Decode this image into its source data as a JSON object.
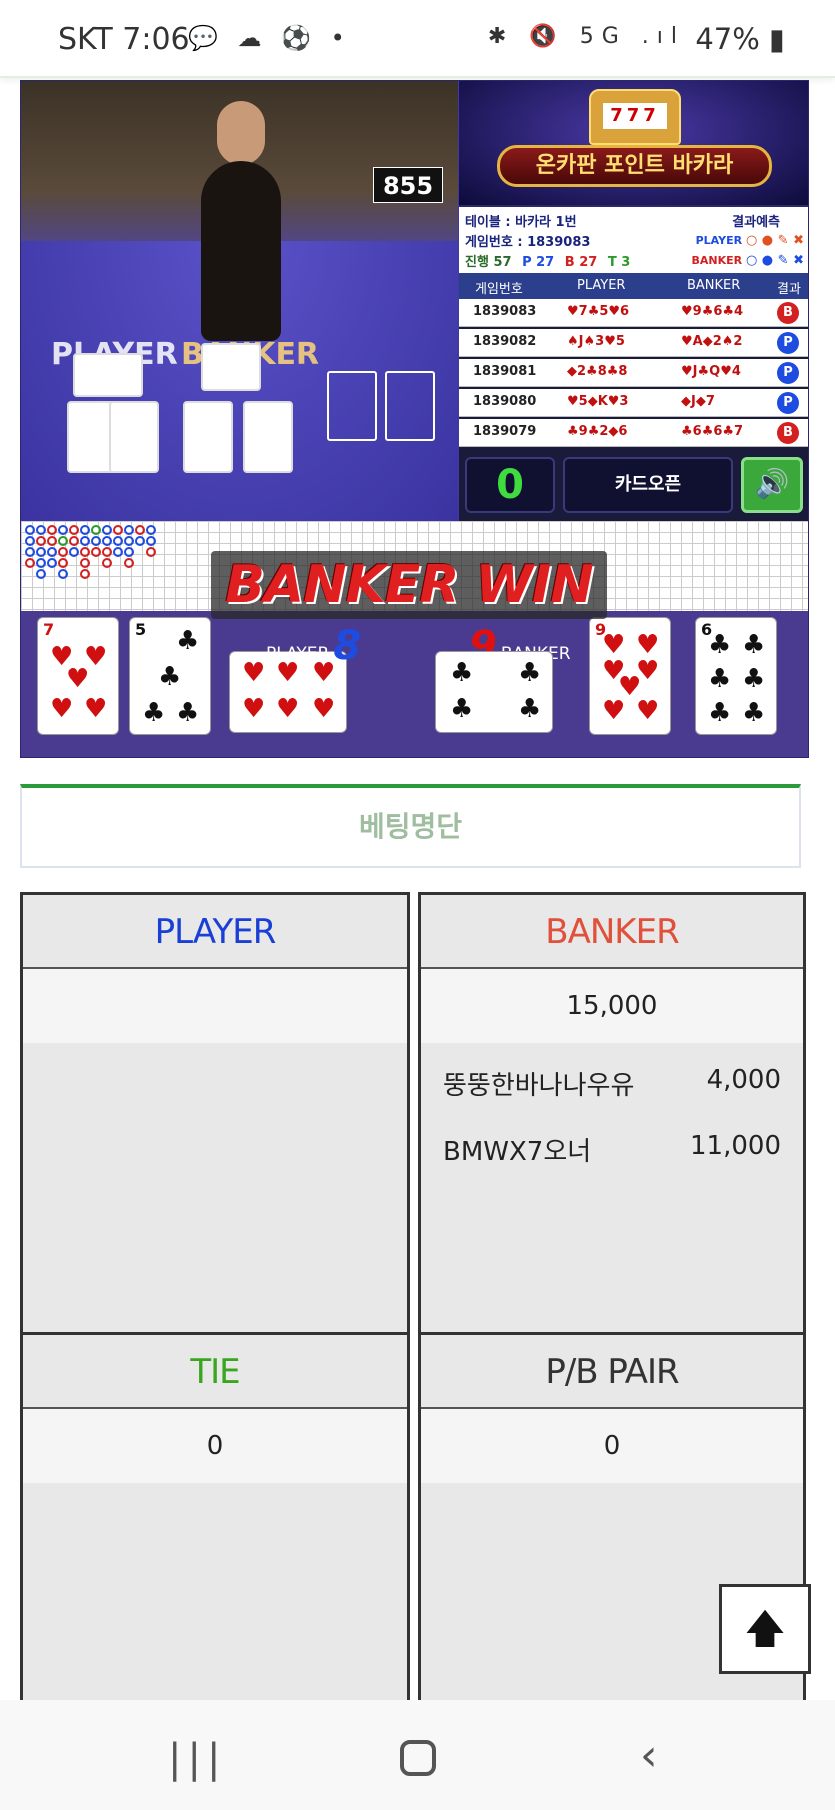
{
  "status_bar": {
    "carrier_time": "SKT 7:06",
    "left_icons": "💬 ☁ ⚽ •",
    "system_icons": "✱ 🔇 5G .ıl",
    "battery": "47%"
  },
  "game": {
    "shoe_counter": "855",
    "felt_player_label": "PLAYER",
    "felt_banker_label": "BANKER",
    "banner_title": "온카판 포인트 바카라",
    "slot_display": "777",
    "info": {
      "table": "테이블 : 바카라 1번",
      "game_no": "게임번호 : 1839083",
      "progress_label": "진행 57",
      "p_count": "P 27",
      "b_count": "B 27",
      "t_count": "T 3",
      "predict_title": "결과예측",
      "predict_player": "PLAYER",
      "predict_banker": "BANKER",
      "predict_player_marks": "○ ● ✎ ✖",
      "predict_banker_marks": "○ ● ✎ ✖"
    },
    "history_headers": [
      "게임번호",
      "PLAYER",
      "BANKER",
      "결과"
    ],
    "history": [
      {
        "no": "1839083",
        "player": "♥7♣5♥6",
        "banker": "♥9♣6♣4",
        "result": "B",
        "result_type": "banker"
      },
      {
        "no": "1839082",
        "player": "♠J♠3♥5",
        "banker": "♥A◆2♠2",
        "result": "P",
        "result_type": "player"
      },
      {
        "no": "1839081",
        "player": "◆2♣8♣8",
        "banker": "♥J♣Q♥4",
        "result": "P",
        "result_type": "player"
      },
      {
        "no": "1839080",
        "player": "♥5◆K♥3",
        "banker": "◆J◆7",
        "result": "P",
        "result_type": "player"
      },
      {
        "no": "1839079",
        "player": "♣9♣2◆6",
        "banker": "♣6♣6♣7",
        "result": "B",
        "result_type": "banker"
      }
    ],
    "counter": "0",
    "card_open_label": "카드오픈",
    "sound_icon": "speaker-icon",
    "win_banner": "BANKER WIN",
    "player_score_label": "PLAYER",
    "player_score": "8",
    "banker_score_label": "BANKER",
    "banker_score": "9",
    "player_cards": [
      {
        "rank": "7",
        "suit": "♥",
        "color": "red"
      },
      {
        "rank": "5",
        "suit": "♣",
        "color": "black"
      },
      {
        "rank": "6",
        "suit": "♥",
        "color": "red"
      }
    ],
    "banker_cards": [
      {
        "rank": "4",
        "suit": "♣",
        "color": "black"
      },
      {
        "rank": "9",
        "suit": "♥",
        "color": "red"
      },
      {
        "rank": "6",
        "suit": "♣",
        "color": "black"
      }
    ]
  },
  "betting": {
    "title": "베팅명단",
    "player": {
      "header": "PLAYER",
      "color": "#1a3fd6",
      "total": ""
    },
    "banker": {
      "header": "BANKER",
      "color": "#e0503a",
      "total": "15,000",
      "rows": [
        {
          "name": "뚱뚱한바나나우유",
          "amount": "4,000"
        },
        {
          "name": "BMWX7오너",
          "amount": "11,000"
        }
      ]
    },
    "tie": {
      "header": "TIE",
      "color": "#3aa620",
      "total": "0"
    },
    "pair": {
      "header": "P/B PAIR",
      "color": "#333333",
      "total": "0"
    }
  },
  "scroll_top_icon": "arrow-up-icon",
  "nav": {
    "recent": "|||",
    "back": "‹"
  }
}
